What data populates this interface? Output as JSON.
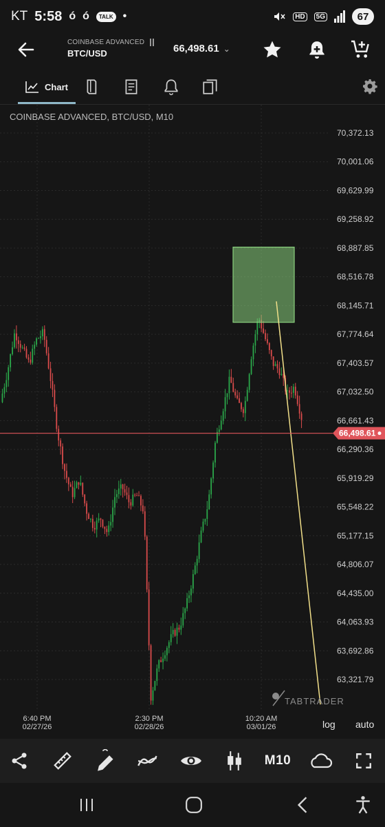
{
  "status_bar": {
    "carrier": "KT",
    "time": "5:58",
    "notif_badge": "TALK",
    "hd_label": "HD",
    "net_label": "5G",
    "battery": "67"
  },
  "header": {
    "exchange": "COINBASE ADVANCED",
    "pair": "BTC/USD",
    "price": "66,498.61",
    "icons": [
      "back-arrow-icon",
      "star-icon",
      "bell-plus-icon",
      "cart-plus-icon"
    ]
  },
  "tabs": {
    "items": [
      {
        "label": "Chart",
        "icon": "chart-line-icon",
        "active": true
      },
      {
        "label": "",
        "icon": "book-icon"
      },
      {
        "label": "",
        "icon": "receipt-icon"
      },
      {
        "label": "",
        "icon": "bell-icon"
      },
      {
        "label": "",
        "icon": "pages-icon"
      }
    ],
    "settings_icon": "gear-icon"
  },
  "chart_data": {
    "type": "candlestick",
    "title": "COINBASE ADVANCED, BTC/USD, M10",
    "current_price_label": "66,498.61",
    "current_price": 66498.61,
    "y_ticks": [
      "70,372.13",
      "70,001.06",
      "69,629.99",
      "69,258.92",
      "68,887.85",
      "68,516.78",
      "68,145.71",
      "67,774.64",
      "67,403.57",
      "67,032.50",
      "66,661.43",
      "66,290.36",
      "65,919.29",
      "65,548.22",
      "65,177.15",
      "64,806.07",
      "64,435.00",
      "64,063.93",
      "63,692.86",
      "63,321.79"
    ],
    "ylim": [
      63000,
      70600
    ],
    "x_ticks": [
      {
        "time": "6:40 PM",
        "date": "02/27/26"
      },
      {
        "time": "2:30 PM",
        "date": "02/28/26"
      },
      {
        "time": "10:20 AM",
        "date": "03/01/26"
      }
    ],
    "price_path": [
      66900,
      67300,
      67800,
      67600,
      67400,
      67700,
      67800,
      67200,
      66500,
      66000,
      65700,
      65900,
      65500,
      65300,
      65400,
      65200,
      65700,
      65800,
      65600,
      65700,
      65500,
      63100,
      63500,
      63700,
      63900,
      64000,
      64300,
      64700,
      65200,
      65600,
      66400,
      66800,
      67200,
      66900,
      66800,
      67500,
      68000,
      67700,
      67400,
      67300,
      67000,
      67100,
      66700
    ],
    "highlight_box": {
      "price_top": 68900,
      "price_bottom": 67930,
      "color": "#8ad17e"
    },
    "trend_line": {
      "from_price": 68200,
      "to_price": 63000,
      "color": "#f2e08a"
    },
    "watermark": "TABTRADER",
    "scale_options": [
      "log",
      "auto"
    ]
  },
  "toolbar": {
    "timeframe": "M10",
    "icons": [
      "share-icon",
      "ruler-icon",
      "pencil-icon",
      "indicator-icon",
      "eye-icon",
      "candles-icon",
      "cloud-icon",
      "fullscreen-icon"
    ]
  },
  "nav": {
    "icons": [
      "recents-icon",
      "home-icon",
      "back-icon",
      "accessibility-icon"
    ]
  },
  "colors": {
    "background": "#161616",
    "up_candle": "#2ba84a",
    "down_candle": "#d94b4b",
    "price_line": "#e0555b",
    "tab_underline": "#8fb8c9"
  }
}
